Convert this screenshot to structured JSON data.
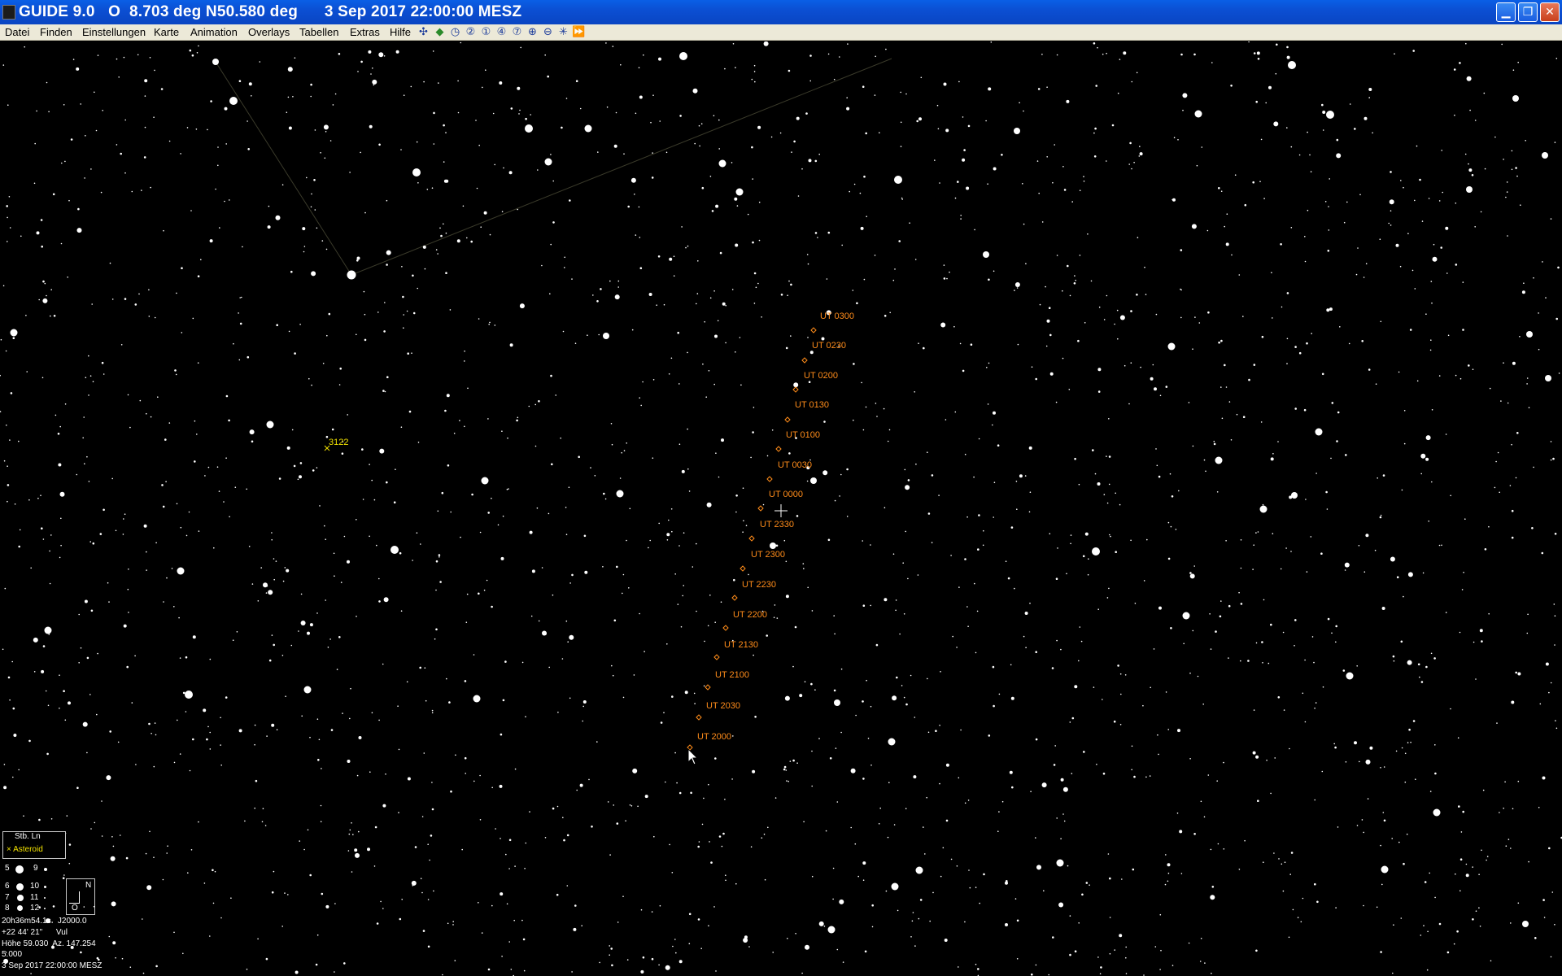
{
  "window": {
    "title": "GUIDE 9.0   O  8.703 deg N50.580 deg      3 Sep 2017 22:00:00 MESZ",
    "minimize_glyph": "▁",
    "maximize_glyph": "❐",
    "close_glyph": "✕"
  },
  "menu": {
    "items": [
      "Datei",
      "Finden",
      "Einstellungen",
      "Karte",
      "Animation",
      "Overlays",
      "Tabellen",
      "Extras",
      "Hilfe"
    ]
  },
  "toolbar": {
    "icons": [
      {
        "name": "legend-toggle-icon",
        "glyph": "✣"
      },
      {
        "name": "ecliptic-toggle-icon",
        "glyph": "◆"
      },
      {
        "name": "time-animation-icon",
        "glyph": "◷"
      },
      {
        "name": "zoom-level-2-icon",
        "glyph": "②"
      },
      {
        "name": "zoom-level-1-icon",
        "glyph": "①"
      },
      {
        "name": "zoom-level-4-icon",
        "glyph": "④"
      },
      {
        "name": "zoom-level-7-icon",
        "glyph": "⑦"
      },
      {
        "name": "zoom-in-icon",
        "glyph": "⊕"
      },
      {
        "name": "zoom-out-icon",
        "glyph": "⊖"
      },
      {
        "name": "grid-toggle-icon",
        "glyph": "✳"
      },
      {
        "name": "fast-forward-icon",
        "glyph": "⏩"
      }
    ]
  },
  "chart": {
    "colors": {
      "background": "#000000",
      "stars": "#ffffff",
      "asteroid_path": "#ff8c1a",
      "asteroid_marker": "#f2e200",
      "constellation_line": "#3a3a2a"
    },
    "asteroid_path_labels": [
      "UT 0300",
      "UT 0230",
      "UT 0200",
      "UT 0130",
      "UT 0100",
      "UT 0030",
      "UT 0000",
      "UT 2330",
      "UT 2300",
      "UT 2230",
      "UT 2200",
      "UT 2130",
      "UT 2100",
      "UT 2030",
      "UT 2000"
    ],
    "asteroid_id": "3122"
  },
  "legend": {
    "title": "Stb. Ln",
    "asteroid_symbol": "×",
    "asteroid_label": "Asteroid",
    "magnitudes": [
      {
        "left": "5",
        "right": "9"
      },
      {
        "left": "6",
        "right": "10"
      },
      {
        "left": "7",
        "right": "11"
      },
      {
        "left": "8",
        "right": "12"
      }
    ],
    "compass_north": "N",
    "compass_east_symbol": "O"
  },
  "info": {
    "ra": "20h36m54.1s   J2000.0",
    "dec": "+22 44' 21\"      Vul",
    "alt_az": "Höhe 59.030  Az. 147.254",
    "scale": "5.000",
    "datetime": "3 Sep 2017 22:00:00 MESZ"
  }
}
